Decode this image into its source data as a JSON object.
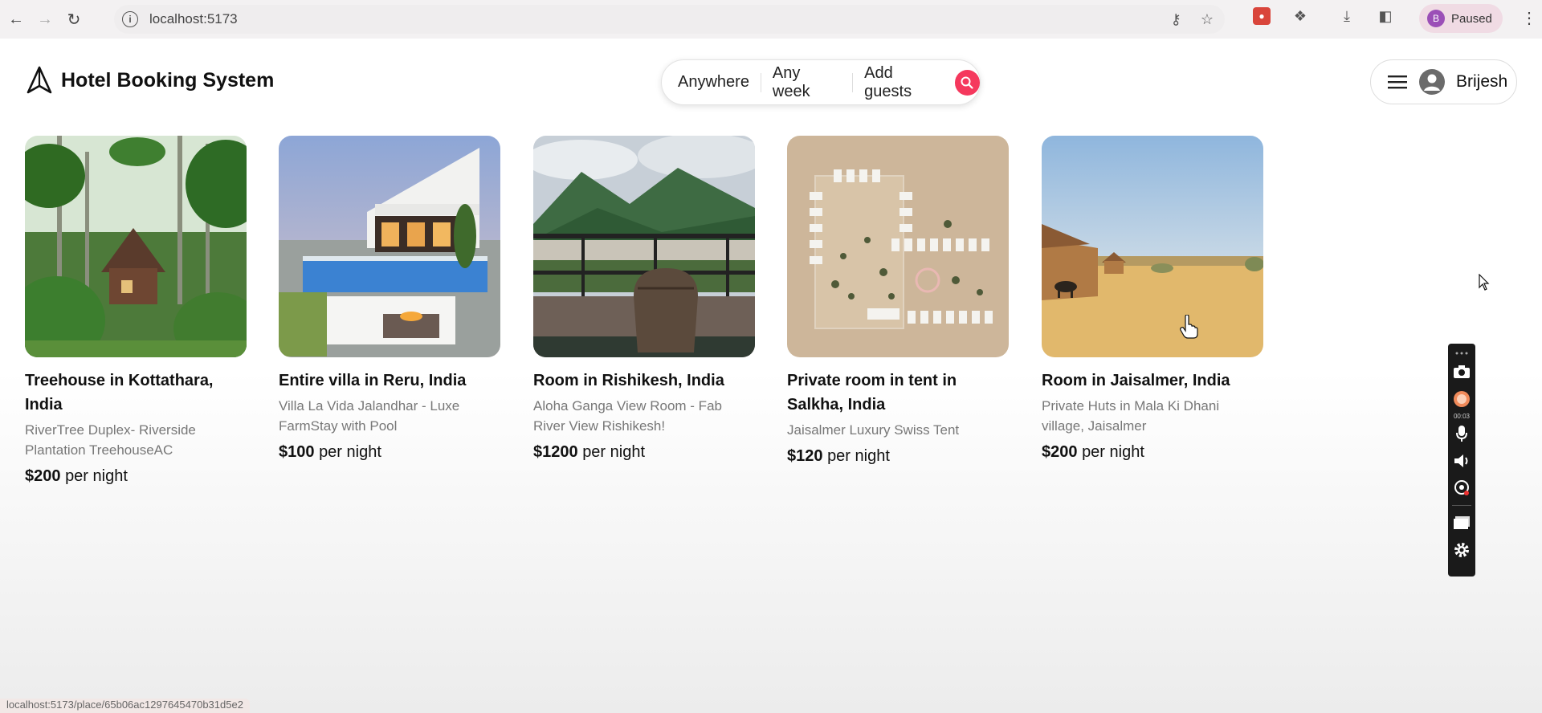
{
  "browser": {
    "url": "localhost:5173",
    "profile_initial": "B",
    "profile_status": "Paused",
    "status_bar_url": "localhost:5173/place/65b06ac1297645470b31d5e2"
  },
  "header": {
    "app_title": "Hotel Booking System",
    "search": {
      "location": "Anywhere",
      "dates": "Any week",
      "guests": "Add guests"
    },
    "user_name": "Brijesh"
  },
  "places": [
    {
      "title": "Treehouse in Kottathara, India",
      "description": "RiverTree Duplex- Riverside Plantation TreehouseAC",
      "price": "$200",
      "price_suffix": "per night"
    },
    {
      "title": "Entire villa in Reru, India",
      "description": "Villa La Vida Jalandhar - Luxe FarmStay with Pool",
      "price": "$100",
      "price_suffix": "per night"
    },
    {
      "title": "Room in Rishikesh, India",
      "description": "Aloha Ganga View Room - Fab River View Rishikesh!",
      "price": "$1200",
      "price_suffix": "per night"
    },
    {
      "title": "Private room in tent in Salkha, India",
      "description": "Jaisalmer Luxury Swiss Tent",
      "price": "$120",
      "price_suffix": "per night"
    },
    {
      "title": "Room in Jaisalmer, India",
      "description": "Private Huts in Mala Ki Dhani village, Jaisalmer",
      "price": "$200",
      "price_suffix": "per night"
    }
  ],
  "recorder": {
    "timer": "00:03"
  },
  "colors": {
    "accent": "#f5385d",
    "text": "#111111",
    "muted": "#777777"
  }
}
